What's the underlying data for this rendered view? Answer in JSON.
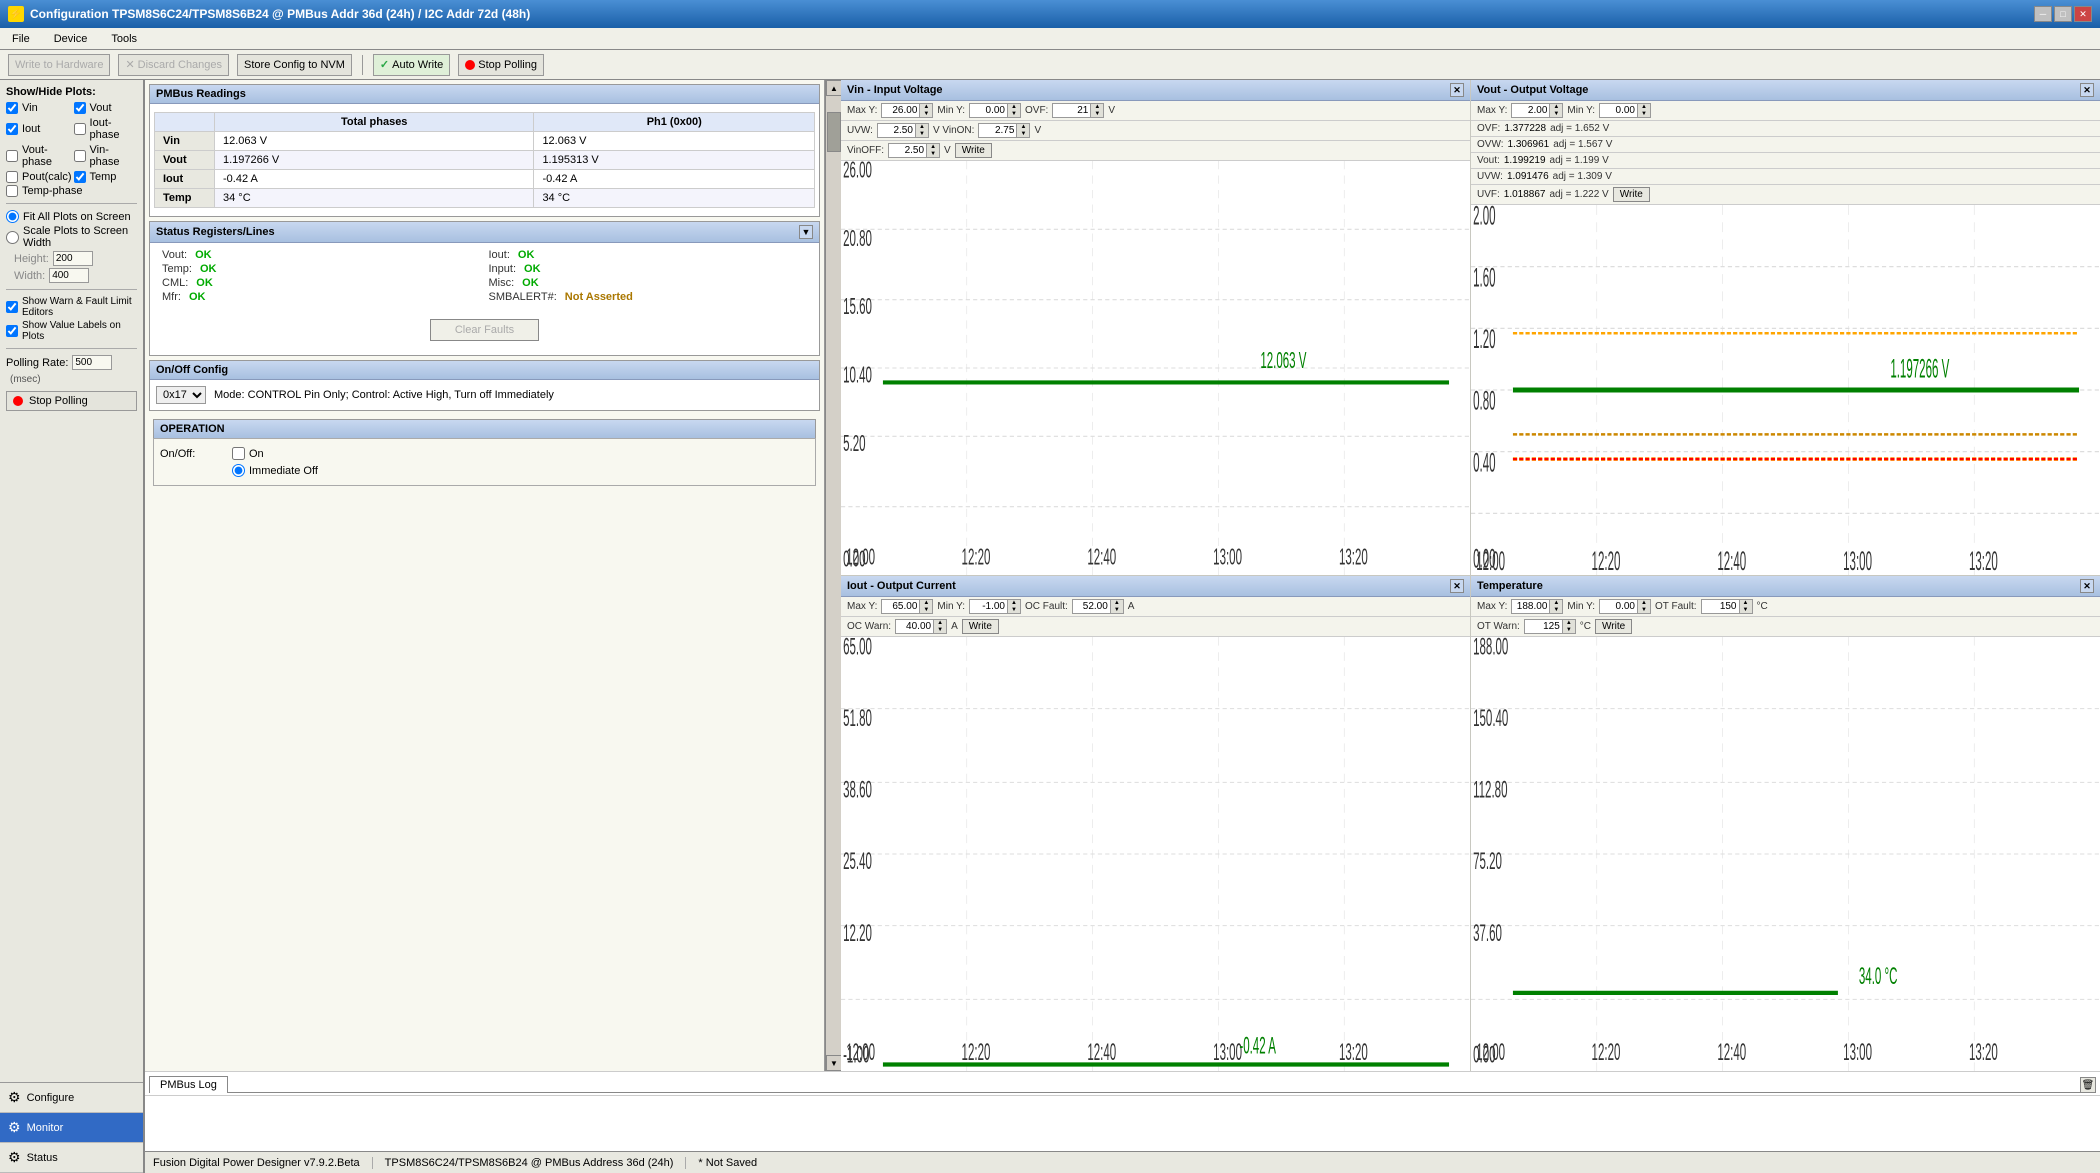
{
  "titleBar": {
    "title": "Configuration TPSM8S6C24/TPSM8S6B24 @ PMBus Addr 36d (24h) / I2C Addr 72d (48h)",
    "icon": "⚡",
    "controls": [
      "─",
      "□",
      "✕"
    ]
  },
  "menuBar": {
    "items": [
      "File",
      "Device",
      "Tools"
    ]
  },
  "toolbar": {
    "writeToHardware": "Write to Hardware",
    "discardChanges": "Discard Changes",
    "storeConfigToNVM": "Store Config to NVM",
    "autoWrite": "Auto Write",
    "stopPolling": "Stop Polling"
  },
  "sidebar": {
    "showHidePlotsLabel": "Show/Hide Plots:",
    "checkboxes": [
      {
        "id": "vin",
        "label": "Vin",
        "checked": true
      },
      {
        "id": "vout",
        "label": "Vout",
        "checked": true
      },
      {
        "id": "iout",
        "label": "Iout",
        "checked": true
      },
      {
        "id": "iout-phase",
        "label": "Iout-phase",
        "checked": false
      },
      {
        "id": "vout-phase",
        "label": "Vout-phase",
        "checked": false
      },
      {
        "id": "vin-phase",
        "label": "Vin-phase",
        "checked": false
      },
      {
        "id": "pout-calc",
        "label": "Pout(calc)",
        "checked": false
      },
      {
        "id": "temp",
        "label": "Temp",
        "checked": true
      },
      {
        "id": "temp-phase",
        "label": "Temp-phase",
        "checked": false
      }
    ],
    "fitAllPlotsOnScreen": "Fit All Plots on Screen",
    "scalePlotsToScreenWidth": "Scale Plots to Screen Width",
    "heightLabel": "Height:",
    "heightValue": "200",
    "widthLabel": "Width:",
    "widthValue": "400",
    "showWarnFaultLimitEditors": "Show Warn & Fault Limit Editors",
    "showValueLabelsOnPlots": "Show Value Labels on Plots",
    "pollingRateLabel": "Polling Rate:",
    "pollingRateValue": "500",
    "pollingRateUnit": "(msec)",
    "stopPollingBtn": "Stop Polling",
    "navItems": [
      {
        "id": "configure",
        "label": "Configure",
        "active": false
      },
      {
        "id": "monitor",
        "label": "Monitor",
        "active": true
      },
      {
        "id": "status",
        "label": "Status",
        "active": false
      }
    ]
  },
  "pmbusReadings": {
    "title": "PMBus Readings",
    "headers": [
      "",
      "Total phases",
      "Ph1 (0x00)"
    ],
    "rows": [
      {
        "label": "Vin",
        "total": "12.063 V",
        "ph1": "12.063 V"
      },
      {
        "label": "Vout",
        "total": "1.197266 V",
        "ph1": "1.195313 V"
      },
      {
        "label": "Iout",
        "total": "-0.42 A",
        "ph1": "-0.42 A"
      },
      {
        "label": "Temp",
        "total": "34 °C",
        "ph1": "34 °C"
      }
    ]
  },
  "statusRegisters": {
    "title": "Status Registers/Lines",
    "items": [
      {
        "label": "Vout:",
        "status": "OK"
      },
      {
        "label": "Iout:",
        "status": "OK"
      },
      {
        "label": "Temp:",
        "status": "OK"
      },
      {
        "label": "Input:",
        "status": "OK"
      },
      {
        "label": "CML:",
        "status": "OK"
      },
      {
        "label": "Misc:",
        "status": "OK"
      },
      {
        "label": "Mfr:",
        "status": "OK"
      },
      {
        "label": "SMBALERT#:",
        "status": "Not Asserted",
        "statusClass": "na"
      }
    ],
    "clearFaultsBtn": "Clear Faults"
  },
  "onOffConfig": {
    "title": "On/Off Config",
    "selectValue": "0x17",
    "description": "Mode: CONTROL Pin Only; Control: Active High, Turn off Immediately"
  },
  "operation": {
    "title": "OPERATION",
    "onOffLabel": "On/Off:",
    "onLabel": "On",
    "onChecked": false,
    "immediateOffLabel": "Immediate Off",
    "immediateOffSelected": true
  },
  "charts": {
    "vin": {
      "title": "Vin - Input Voltage",
      "maxY": "26.00",
      "minY": "0.00",
      "ovf": "21",
      "uvw": "2.50",
      "vinOn": "2.75",
      "vinOff": "2.50",
      "unit": "V",
      "currentValue": "12.063 V",
      "times": [
        "12:00",
        "12:20",
        "12:40",
        "13:00",
        "13:20"
      ],
      "yLabels": [
        "26.00",
        "20.80",
        "15.60",
        "10.40",
        "5.20",
        "0.00"
      ]
    },
    "vout": {
      "title": "Vout - Output Voltage",
      "maxY": "2.00",
      "minY": "0.00",
      "ovf": "1.377228",
      "ovw": "1.306961",
      "vout": "1.199219",
      "uvw": "1.091476",
      "uvf": "1.018867",
      "ovfAdj": "1.652",
      "ovwAdj": "1.567",
      "voutAdj": "1.199",
      "uvwAdj": "1.309",
      "uvfAdj": "1.222",
      "unit": "V",
      "currentValue": "1.197266 V",
      "times": [
        "12:00",
        "12:20",
        "12:40",
        "13:00",
        "13:20"
      ],
      "yLabels": [
        "2.00",
        "1.60",
        "1.20",
        "0.80",
        "0.40",
        "0.00"
      ]
    },
    "iout": {
      "title": "Iout - Output Current",
      "maxY": "65.00",
      "minY": "-1.00",
      "ocFault": "52.00",
      "ocWarn": "40.00",
      "unit": "A",
      "currentValue": "-0.42 A",
      "times": [
        "12:00",
        "12:20",
        "12:40",
        "13:00",
        "13:20"
      ],
      "yLabels": [
        "65.00",
        "51.80",
        "38.60",
        "25.40",
        "12.20",
        "-1.00"
      ]
    },
    "temp": {
      "title": "Temperature",
      "maxY": "188.00",
      "minY": "0.00",
      "otFault": "150",
      "otWarn": "125",
      "unit": "°C",
      "currentValue": "34.0 °C",
      "times": [
        "12:00",
        "12:20",
        "12:40",
        "13:00",
        "13:20"
      ],
      "yLabels": [
        "188.00",
        "150.40",
        "112.80",
        "75.20",
        "37.60",
        "0.00"
      ]
    }
  },
  "bottomTabs": {
    "pmbusLog": "PMBus Log"
  },
  "statusBar": {
    "appVersion": "Fusion Digital Power Designer v7.9.2.Beta",
    "deviceInfo": "TPSM8S6C24/TPSM8S6B24 @ PMBus Address 36d (24h)",
    "saveStatus": "* Not Saved"
  }
}
